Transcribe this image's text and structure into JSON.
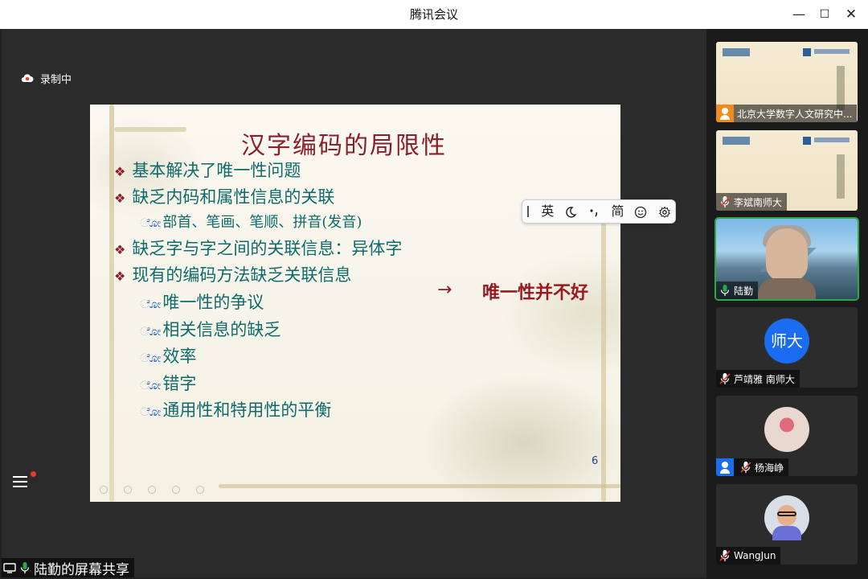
{
  "window": {
    "title": "腾讯会议",
    "minimize": "—",
    "maximize": "☐",
    "close": "✕"
  },
  "recording": {
    "label": "录制中"
  },
  "slide": {
    "title": "汉字编码的局限性",
    "bullets": [
      "基本解决了唯一性问题",
      "缺乏内码和属性信息的关联",
      "缺乏字与字之间的关联信息：异体字",
      "现有的编码方法缺乏关联信息"
    ],
    "sub_bullet_1": "部首、笔画、笔顺、拼音(发音)",
    "sub_bullets_4": [
      "唯一性的争议",
      "相关信息的缺乏",
      "效率",
      "错字",
      "通用性和特用性的平衡"
    ],
    "arrow": "→",
    "callout": "唯一性并不好",
    "page_number": "6"
  },
  "ime_toolbar": {
    "lang": "英",
    "mode": "简"
  },
  "share_label": {
    "text": "陆勤的屏幕共享"
  },
  "participants": [
    {
      "name": "北京大学数字人文研究中...",
      "type": "slide",
      "muted": false
    },
    {
      "name": "李斌南师大",
      "type": "slide",
      "muted": true
    },
    {
      "name": "陆勤",
      "type": "video",
      "muted": false,
      "speaking": true
    },
    {
      "name": "芦靖雅 南师大",
      "type": "text-avatar",
      "avatar_text": "师大",
      "muted": true
    },
    {
      "name": "杨海峥",
      "type": "photo",
      "muted": true
    },
    {
      "name": "WangJun",
      "type": "cartoon",
      "muted": true
    }
  ],
  "colors": {
    "title_red": "#8a1f2c",
    "bullet_teal": "#0f6b6b",
    "accent_blue": "#1a6cf0",
    "speaking_green": "#2aa84a"
  }
}
